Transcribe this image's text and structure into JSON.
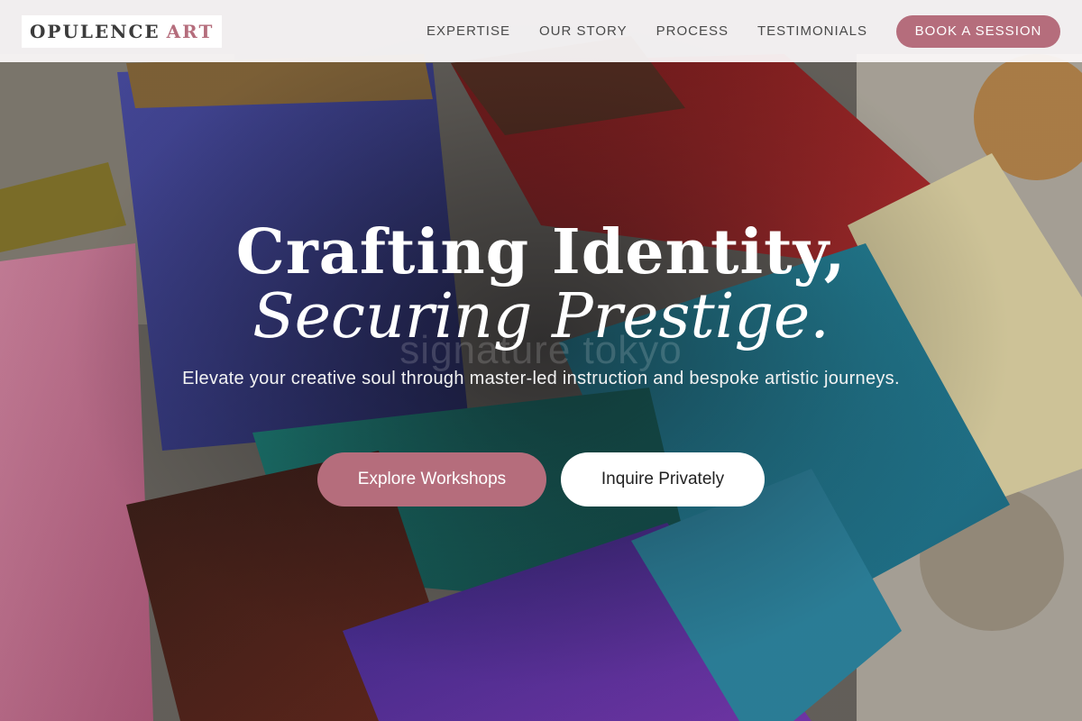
{
  "brand": {
    "name_part1": "OPULENCE",
    "name_part2": "ART"
  },
  "nav": {
    "items": [
      {
        "label": "EXPERTISE"
      },
      {
        "label": "OUR STORY"
      },
      {
        "label": "PROCESS"
      },
      {
        "label": "TESTIMONIALS"
      }
    ],
    "cta_label": "BOOK A SESSION"
  },
  "hero": {
    "title_line1": "Crafting Identity,",
    "title_line2": "Securing Prestige.",
    "watermark": "signature tokyo",
    "subtitle": "Elevate your creative soul through master-led instruction and bespoke artistic journeys.",
    "primary_cta": "Explore Workshops",
    "secondary_cta": "Inquire Privately"
  },
  "colors": {
    "accent": "#b56d7c",
    "header_bg": "#fcfafb",
    "text_light": "#ffffff"
  }
}
